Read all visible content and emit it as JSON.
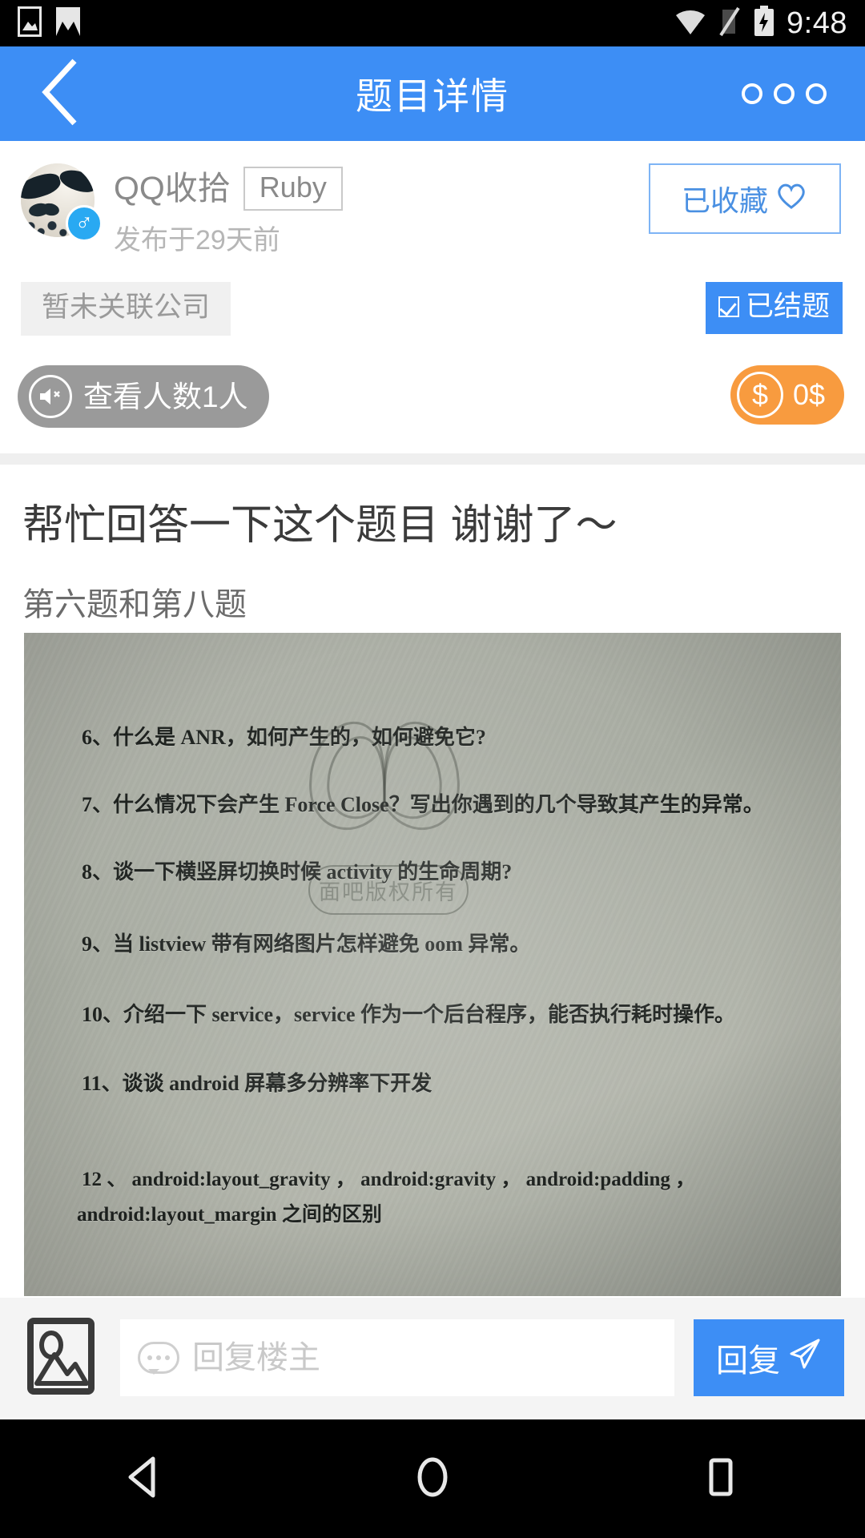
{
  "status_bar": {
    "time": "9:48",
    "icons": [
      "image-icon",
      "mail-icon",
      "wifi-warning-icon",
      "signal-off-icon",
      "battery-charging-icon"
    ]
  },
  "header": {
    "title": "题目详情",
    "back_icon": "back-chevron-icon",
    "more_icon": "more-options-icon"
  },
  "post_meta": {
    "username": "QQ收拾",
    "user_tag": "Ruby",
    "gender_icon": "male-icon",
    "posted_time": "发布于29天前",
    "favorite_label": "已收藏",
    "favorite_icon": "heart-outline-icon",
    "company_label": "暂未关联公司",
    "solved_label": "已结题",
    "solved_icon": "checkbox-checked-icon",
    "views_label": "查看人数1人",
    "views_icon": "speaker-icon",
    "reward_amount": "0$",
    "reward_icon": "dollar-coin-icon"
  },
  "post": {
    "title": "帮忙回答一下这个题目 谢谢了～",
    "subtitle": "第六题和第八题",
    "attachment": {
      "name": "exam-paper-photo",
      "watermark_text": "面吧版权所有",
      "watermark_logo": "infinity-m-logo",
      "lines": [
        "6、什么是 ANR，如何产生的，如何避免它?",
        "7、什么情况下会产生 Force Close？写出你遇到的几个导致其产生的异常。",
        "8、谈一下横竖屏切换时候 activity 的生命周期?",
        "9、当 listview 带有网络图片怎样避免 oom 异常。",
        "10、介绍一下 service，service 作为一个后台程序，能否执行耗时操作。",
        "11、谈谈 android 屏幕多分辨率下开发",
        "12 、  android:layout_gravity ，  android:gravity ，  android:padding ，",
        "android:layout_margin 之间的区别"
      ]
    }
  },
  "reply_bar": {
    "image_icon": "image-picker-icon",
    "comment_icon": "comment-bubble-icon",
    "placeholder": "回复楼主",
    "input_value": "",
    "send_label": "回复",
    "send_icon": "send-plane-icon"
  },
  "nav_bar": {
    "back_icon": "nav-back-icon",
    "home_icon": "nav-home-icon",
    "recents_icon": "nav-recents-icon"
  },
  "colors": {
    "accent_blue": "#3d8ef5",
    "orange": "#f89b3f",
    "gray_pill": "#9a9a9a"
  }
}
